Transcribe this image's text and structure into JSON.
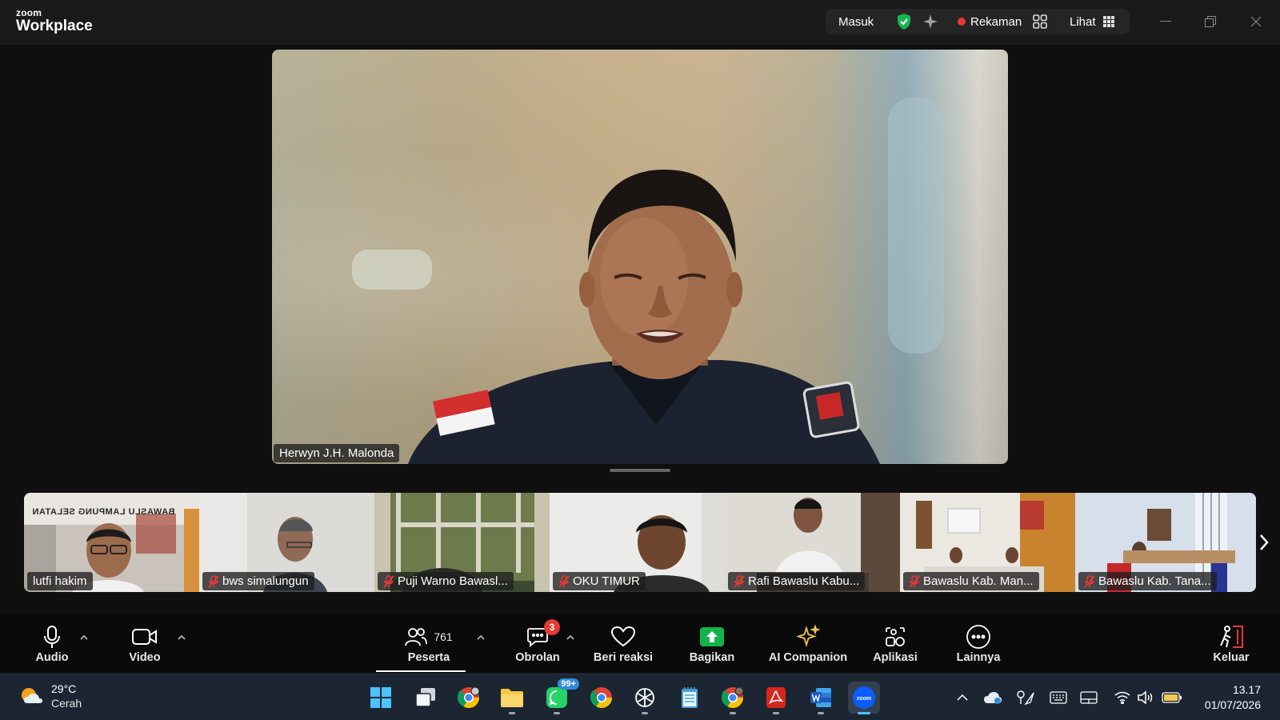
{
  "app": {
    "brand_small": "zoom",
    "brand_big": "Workplace"
  },
  "titlebar": {
    "masuk": "Masuk",
    "rekaman": "Rekaman",
    "lihat": "Lihat"
  },
  "speaker": {
    "name": "Herwyn J.H. Malonda"
  },
  "participants": [
    {
      "name": "lutfi hakim",
      "muted": false,
      "sign_text": "BAWASLU LAMPUNG SELATAN"
    },
    {
      "name": "bws simalungun",
      "muted": true
    },
    {
      "name": "Puji Warno Bawasl...",
      "muted": true
    },
    {
      "name": "OKU TIMUR",
      "muted": true
    },
    {
      "name": "Rafi Bawaslu Kabu...",
      "muted": true
    },
    {
      "name": "Bawaslu Kab. Man...",
      "muted": true
    },
    {
      "name": "Bawaslu Kab. Tana...",
      "muted": true
    }
  ],
  "toolbar": {
    "audio": "Audio",
    "video": "Video",
    "peserta": "Peserta",
    "peserta_count": "761",
    "obrolan": "Obrolan",
    "obrolan_badge": "3",
    "reaksi": "Beri reaksi",
    "bagikan": "Bagikan",
    "ai": "AI Companion",
    "aplikasi": "Aplikasi",
    "lainnya": "Lainnya",
    "keluar": "Keluar"
  },
  "taskbar": {
    "weather_temp": "29°C",
    "weather_desc": "Cerah",
    "whatsapp_badge": "99+",
    "time": "13.17",
    "date": "01/07/2026"
  },
  "colors": {
    "accent_green": "#17b350",
    "record_red": "#e53935",
    "danger": "#e53935",
    "share_green": "#12b34b",
    "ai_gold": "#f2c24a"
  }
}
